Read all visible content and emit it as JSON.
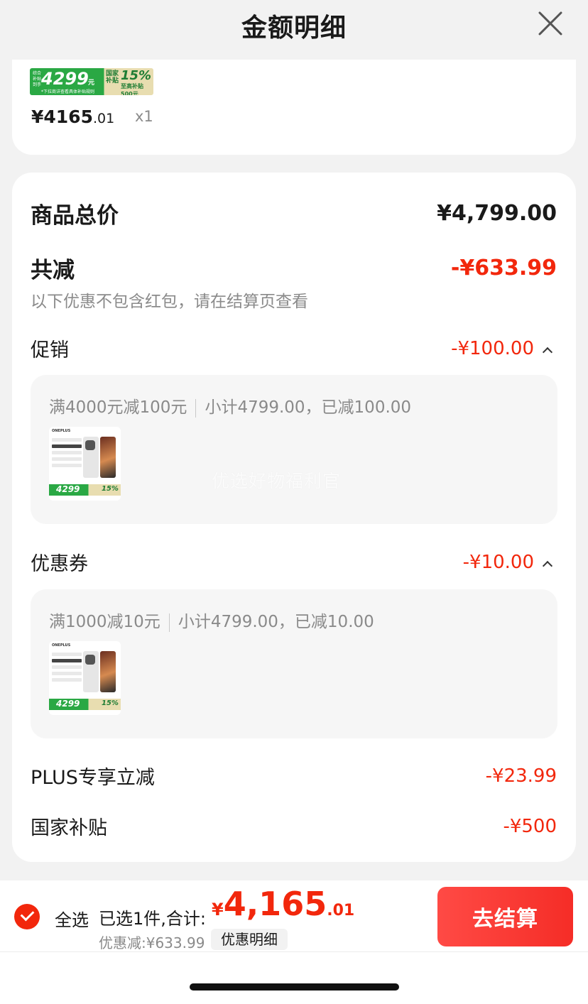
{
  "header": {
    "title": "金额明细"
  },
  "product": {
    "banner": {
      "tag": "综合补贴到手",
      "price": "4299",
      "unit": "元",
      "national": "国家补贴",
      "percent": "15%",
      "max": "至高补贴500元",
      "note": "*下拉商详查看具体补贴规则"
    },
    "price_main": "¥4165",
    "price_dec": ".01",
    "quantity": "x1"
  },
  "summary": {
    "total_label": "商品总价",
    "total_value": "¥4,799.00",
    "reduce_label": "共减",
    "reduce_value": "-¥633.99",
    "note": "以下优惠不包含红包，请在结算页查看"
  },
  "promotion": {
    "label": "促销",
    "value": "-¥100.00",
    "rule": "满4000元减100元",
    "detail": "小计4799.00，已减100.00",
    "thumb": {
      "logo": "ONEPLUS",
      "price": "4299",
      "percent": "15%"
    }
  },
  "watermark": "优选好物福利官",
  "coupon": {
    "label": "优惠券",
    "value": "-¥10.00",
    "rule": "满1000减10元",
    "detail": "小计4799.00，已减10.00",
    "thumb": {
      "logo": "ONEPLUS",
      "price": "4299",
      "percent": "15%"
    }
  },
  "plus": {
    "label": "PLUS专享立减",
    "value": "-¥23.99"
  },
  "subsidy": {
    "label": "国家补贴",
    "value": "-¥500"
  },
  "footer": {
    "select_all": "全选",
    "selected_text": "已选1件,合计:",
    "currency": "¥",
    "total_int": "4,165",
    "total_dec": ".01",
    "discount_text": "优惠减:¥633.99",
    "detail_button": "优惠明细",
    "checkout_button": "去结算"
  },
  "colors": {
    "accent": "#f2270c",
    "background": "#f2f2f2",
    "subsidy_green": "#2aa844"
  }
}
